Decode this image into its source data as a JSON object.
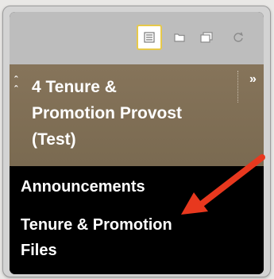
{
  "toolbar": {
    "buttons": [
      {
        "icon": "list-view-icon",
        "active": true
      },
      {
        "icon": "folder-view-icon",
        "active": false
      },
      {
        "icon": "windows-view-icon",
        "active": false
      },
      {
        "icon": "refresh-icon",
        "active": false
      }
    ]
  },
  "course": {
    "title_lines": [
      "4 Tenure &",
      "Promotion Provost",
      "(Test)"
    ],
    "collapse_icon": "collapse-up-icon",
    "expand_icon": "expand-right-icon"
  },
  "menu": {
    "items": [
      {
        "lines": [
          "Announcements"
        ]
      },
      {
        "lines": [
          "Tenure & Promotion",
          "Files"
        ]
      }
    ]
  },
  "colors": {
    "toolbar_bg": "#bdbdbd",
    "header_bg": "#7f6e55",
    "menu_bg": "#000000",
    "active_border": "#e7c94a",
    "annotation_arrow": "#e8381e"
  }
}
